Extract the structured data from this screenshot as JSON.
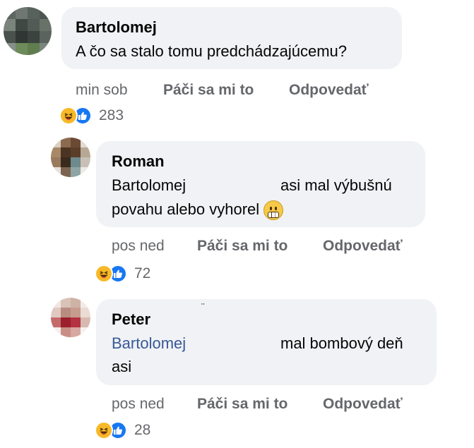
{
  "comments": [
    {
      "author": "Bartolomej",
      "text": "A čo sa stalo tomu predchádzajúcemu?",
      "time": "min sob",
      "like_label": "Páči sa mi to",
      "reply_label": "Odpovedať",
      "reaction_count": "283"
    },
    {
      "author": "Roman",
      "mention": "Bartolomej",
      "text_line1": "asi mal výbušnú",
      "text_line2": "povahu alebo vyhorel",
      "emoji": "grimacing-face",
      "time": "pos ned",
      "like_label": "Páči sa mi to",
      "reply_label": "Odpovedať",
      "reaction_count": "72"
    },
    {
      "author": "Peter",
      "mention": "Bartolomej",
      "text_line1": "mal bombový deň",
      "text_line2": "asi",
      "time": "pos ned",
      "like_label": "Páči sa mi to",
      "reply_label": "Odpovedať",
      "reaction_count": "28"
    }
  ],
  "reaction_icons": [
    "haha-icon",
    "like-icon"
  ],
  "colors": {
    "bubble": "#f0f2f5",
    "mention": "#385898",
    "meta": "#65676b",
    "like_blue": "#1877f2",
    "haha_yellow": "#f7b928"
  }
}
